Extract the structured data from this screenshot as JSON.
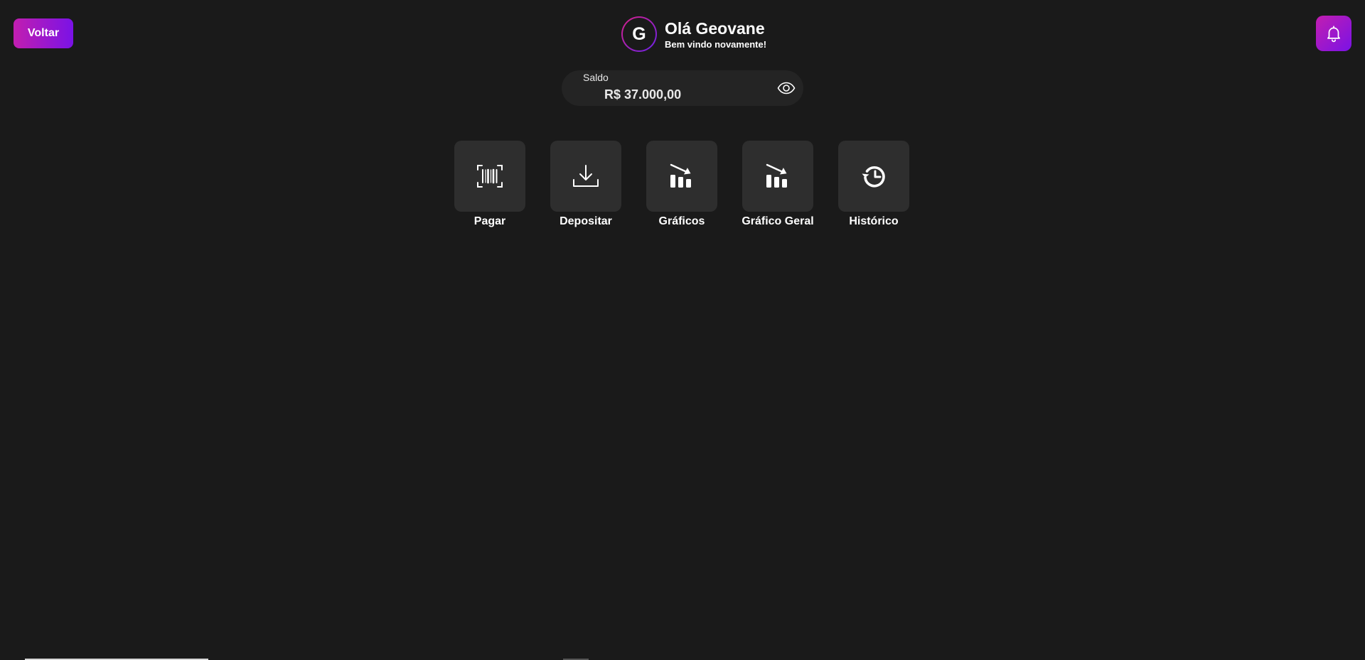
{
  "nav": {
    "back_label": "Voltar",
    "notifications_icon": "bell-icon"
  },
  "header": {
    "avatar_initial": "G",
    "greeting": "Olá Geovane",
    "subtitle": "Bem vindo novamente!"
  },
  "balance": {
    "label": "Saldo",
    "value": "R$ 37.000,00",
    "toggle_icon": "eye-icon"
  },
  "actions": [
    {
      "label": "Pagar",
      "icon": "barcode-scan-icon"
    },
    {
      "label": "Depositar",
      "icon": "download-icon"
    },
    {
      "label": "Gráficos",
      "icon": "chart-trend-down-icon"
    },
    {
      "label": "Gráfico Geral",
      "icon": "chart-trend-down-icon"
    },
    {
      "label": "Histórico",
      "icon": "history-icon"
    }
  ],
  "colors": {
    "background": "#1a1a1a",
    "accent_start": "#c21eb0",
    "accent_end": "#7a12e6",
    "tile": "#2e2e2e",
    "card": "#242424"
  }
}
